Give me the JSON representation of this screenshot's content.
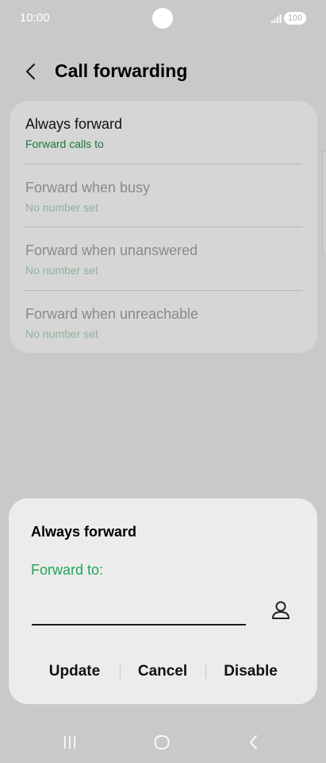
{
  "status_bar": {
    "time": "10:00",
    "battery_level": "100",
    "icons": [
      "camera-cutout-icon",
      "signal-icon",
      "battery-icon"
    ]
  },
  "header": {
    "back_icon": "back-arrow-icon",
    "title": "Call forwarding"
  },
  "forwarding_options": [
    {
      "title": "Always forward",
      "subtitle": "Forward calls to",
      "enabled": true
    },
    {
      "title": "Forward when busy",
      "subtitle": "No number set",
      "enabled": false
    },
    {
      "title": "Forward when unanswered",
      "subtitle": "No number set",
      "enabled": false
    },
    {
      "title": "Forward when unreachable",
      "subtitle": "No number set",
      "enabled": false
    }
  ],
  "dialog": {
    "title": "Always forward",
    "field_label": "Forward to:",
    "field_value": "",
    "contact_icon": "contact-person-icon",
    "actions": {
      "update": "Update",
      "cancel": "Cancel",
      "disable": "Disable"
    }
  },
  "nav_bar": {
    "icons": [
      "recent-apps-icon",
      "home-icon",
      "back-icon"
    ]
  },
  "colors": {
    "background": "#c9c9c9",
    "card": "#d6d6d6",
    "dialog": "#ececec",
    "accent_green": "#1fa65a",
    "enabled_subtitle": "#1b7a3e",
    "disabled_text": "#8a8a8a",
    "disabled_subtitle": "#8fb39a"
  }
}
